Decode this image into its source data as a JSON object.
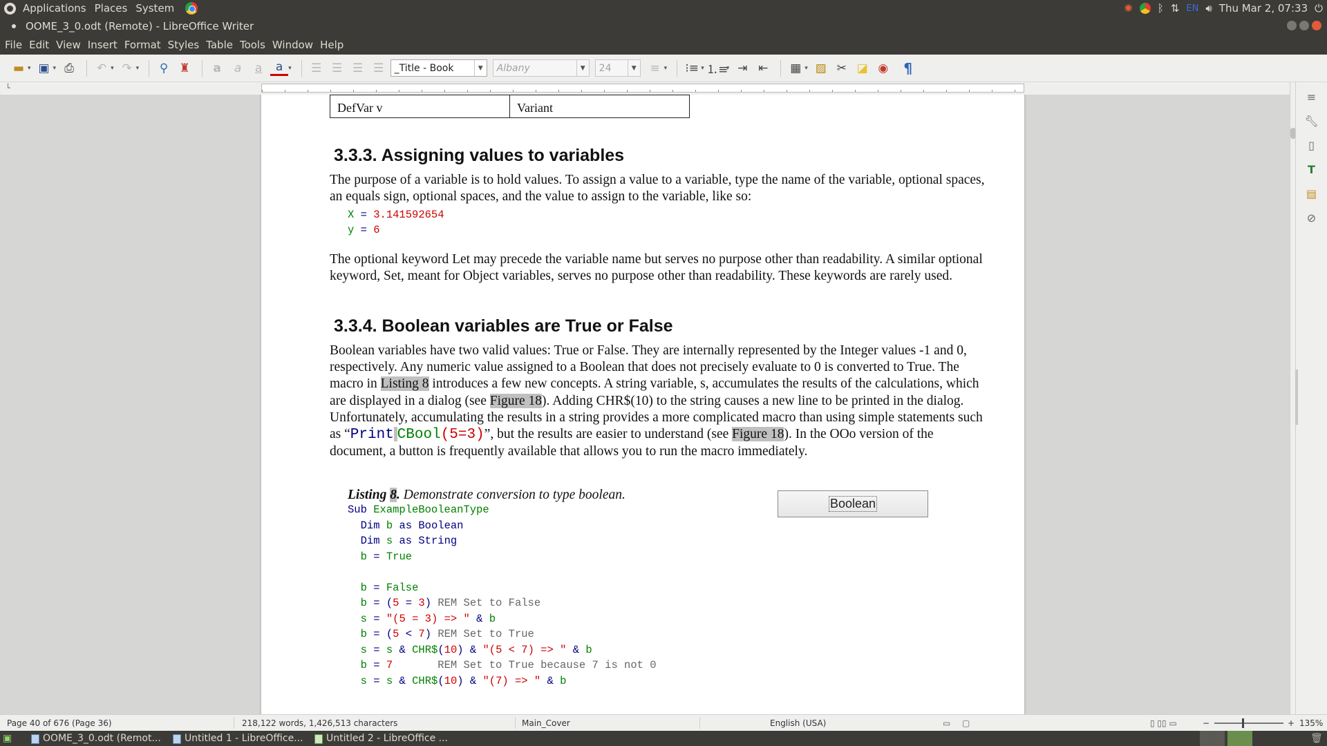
{
  "top_panel": {
    "menus": [
      "Applications",
      "Places",
      "System"
    ],
    "input_lang": "EN",
    "clock": "Thu Mar 2, 07:33"
  },
  "window": {
    "title": "OOME_3_0.odt (Remote) - LibreOffice Writer"
  },
  "menubar": [
    "File",
    "Edit",
    "View",
    "Insert",
    "Format",
    "Styles",
    "Table",
    "Tools",
    "Window",
    "Help"
  ],
  "toolbar": {
    "paragraph_style": "_Title - Book",
    "font_name": "Albany",
    "font_size": "24"
  },
  "document": {
    "table_row": [
      "DefVar v",
      "Variant"
    ],
    "heading1": "3.3.3. Assigning values to variables",
    "para1": "The purpose of a variable is to hold values. To assign a value to a variable, type the name of the variable, optional spaces, an equals sign, optional spaces, and the value to assign to the variable, like so:",
    "code1_line1": {
      "var": "X",
      "op": " = ",
      "val": "3.141592654"
    },
    "code1_line2": {
      "var": "y",
      "op": " = ",
      "val": "6"
    },
    "para2": "The optional keyword Let may precede the variable name but serves no purpose other than readability. A similar optional keyword, Set, meant for Object variables, serves no purpose other than readability. These keywords are rarely used.",
    "heading2": "3.3.4. Boolean variables are True or False",
    "para3_a": "Boolean variables have two valid values: True or False. They are internally represented by the Integer values -1 and 0, respectively. Any numeric value assigned to a Boolean that does not precisely evaluate to 0 is converted to True. The macro in ",
    "para3_ref1": "Listing 8",
    "para3_b": " introduces a few new concepts. A string variable, s, accumulates the results of the calculations, which are displayed in a dialog (see ",
    "para3_ref2": "Figure 18",
    "para3_c": "). Adding CHR$(10) to the string causes a new line to be printed in the dialog. Unfortunately, accumulating the results in a string provides a more complicated macro than using simple statements such as “",
    "para3_code_print": "Print",
    "para3_code_cbool": "CBool",
    "para3_code_args": "(5=3)",
    "para3_d": "”, but the results are easier to understand (see ",
    "para3_ref3": "Figure 18",
    "para3_e": "). In the OOo version of the document, a button is frequently available that allows you to run the macro immediately.",
    "caption_label": "Listing ",
    "caption_num": "8",
    "caption_text": ". Demonstrate conversion to type boolean.",
    "button_label": "Boolean"
  },
  "statusbar": {
    "page": "Page 40 of 676 (Page 36)",
    "words": "218,122 words, 1,426,513 characters",
    "page_style": "Main_Cover",
    "language": "English (USA)",
    "zoom": "135%"
  },
  "taskbar": [
    "OOME_3_0.odt (Remot...",
    "Untitled 1 - LibreOffice...",
    "Untitled 2 - LibreOffice ..."
  ],
  "colors": {
    "code_keyword": "#000080",
    "code_identifier": "#008000",
    "code_number": "#cc0000",
    "code_comment": "#666666",
    "field_highlight": "#c0c0c0",
    "panel_bg": "#3c3b37"
  }
}
